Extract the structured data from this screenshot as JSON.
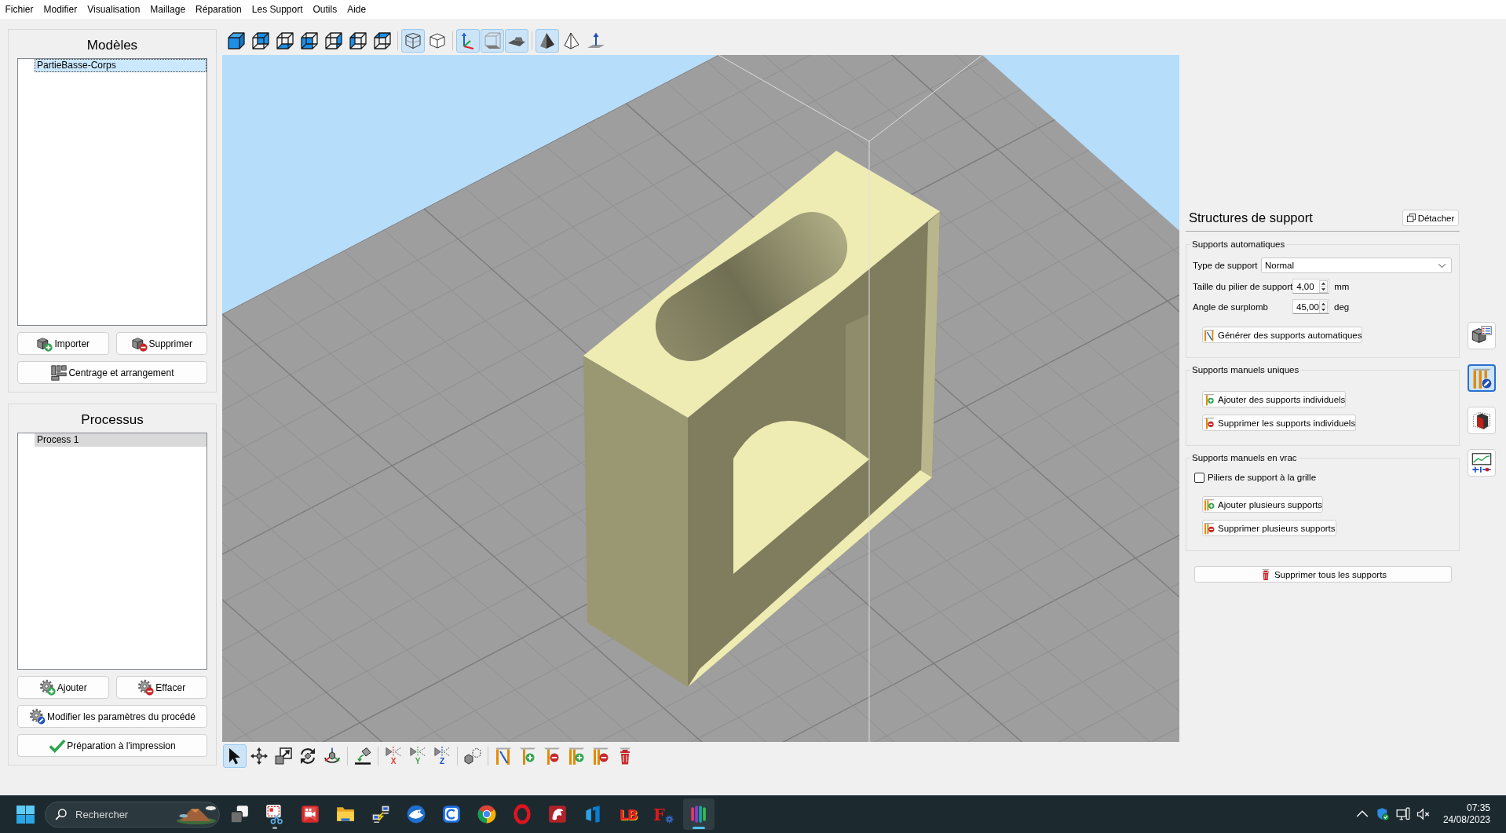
{
  "menu_bar": [
    "Fichier",
    "Modifier",
    "Visualisation",
    "Maillage",
    "Réparation",
    "Les Support",
    "Outils",
    "Aide"
  ],
  "view_toolbar": [
    [
      {
        "kind": "cube-all",
        "selected": false
      },
      {
        "kind": "cube-back",
        "selected": false
      },
      {
        "kind": "cube-bottom",
        "selected": false
      },
      {
        "kind": "cube-front",
        "selected": false
      },
      {
        "kind": "cube-right",
        "selected": false
      },
      {
        "kind": "cube-left",
        "selected": false
      },
      {
        "kind": "cube-top",
        "selected": false
      }
    ],
    [
      {
        "kind": "perspective",
        "selected": true
      },
      {
        "kind": "orthographic",
        "selected": false
      }
    ],
    [
      {
        "kind": "axes",
        "selected": true
      },
      {
        "kind": "bounding-box",
        "selected": true
      },
      {
        "kind": "build-plate",
        "selected": true
      }
    ],
    [
      {
        "kind": "shaded",
        "selected": true
      },
      {
        "kind": "wireframe",
        "selected": false
      },
      {
        "kind": "plate-arrow",
        "selected": false
      }
    ]
  ],
  "models_panel": {
    "title": "Modèles",
    "focused": true,
    "items": [
      {
        "label": "PartieBasse-Corps",
        "selected": true
      }
    ],
    "buttons": [
      [
        {
          "kind": "import",
          "label": "Importer"
        },
        {
          "kind": "remove",
          "label": "Supprimer"
        }
      ],
      [
        {
          "kind": "arrange",
          "label": "Centrage et arrangement"
        }
      ]
    ]
  },
  "process_panel": {
    "title": "Processus",
    "focused": false,
    "items": [
      {
        "label": "Process 1",
        "selected": true
      }
    ],
    "buttons": [
      [
        {
          "kind": "add",
          "label": "Ajouter"
        },
        {
          "kind": "erase",
          "label": "Effacer"
        }
      ],
      [
        {
          "kind": "settings",
          "label": "Modifier les paramètres du procédé"
        }
      ],
      [
        {
          "kind": "prepare",
          "label": "Préparation à l'impression"
        }
      ]
    ]
  },
  "bottom_toolbar": [
    [
      {
        "kind": "select",
        "selected": true
      },
      {
        "kind": "move",
        "selected": false
      },
      {
        "kind": "scale",
        "selected": false
      },
      {
        "kind": "rotate",
        "selected": false
      },
      {
        "kind": "rotate-3d",
        "selected": false
      }
    ],
    [
      {
        "kind": "place-face",
        "selected": false
      }
    ],
    [
      {
        "kind": "mirror",
        "label": "X",
        "color": "#e53935",
        "selected": false
      },
      {
        "kind": "mirror",
        "label": "Y",
        "color": "#43a047",
        "selected": false
      },
      {
        "kind": "mirror",
        "label": "Z",
        "color": "#1e4fc2",
        "selected": false
      }
    ],
    [
      {
        "kind": "duplicate",
        "selected": false
      }
    ],
    [
      {
        "kind": "auto-support",
        "selected": false
      },
      {
        "kind": "add-support",
        "selected": false
      },
      {
        "kind": "remove-support",
        "selected": false
      },
      {
        "kind": "add-supports",
        "selected": false
      },
      {
        "kind": "remove-supports",
        "selected": false
      },
      {
        "kind": "delete-supports",
        "selected": false
      }
    ]
  ],
  "support_panel": {
    "title": "Structures de support",
    "detach_label": "Détacher",
    "groups": [
      {
        "title": "Supports automatiques",
        "rows": [
          {
            "kind": "combo",
            "label": "Type de support",
            "value": "Normal"
          },
          {
            "kind": "spin",
            "label": "Taille du pilier de support",
            "value": "4,00",
            "unit": "mm"
          },
          {
            "kind": "spin",
            "label": "Angle de surplomb",
            "value": "45,00",
            "unit": "deg"
          },
          {
            "kind": "auto-support",
            "label": "Générer des supports automatiques"
          }
        ]
      },
      {
        "title": "Supports manuels uniques",
        "rows": [
          {
            "kind": "add-support",
            "label": "Ajouter des supports individuels"
          },
          {
            "kind": "remove-support",
            "label": "Supprimer les supports individuels"
          }
        ]
      },
      {
        "title": "Supports manuels en vrac",
        "rows": [
          {
            "kind": "checkbox",
            "label": "Piliers de support à la grille",
            "checked": false
          },
          {
            "kind": "add-supports",
            "label": "Ajouter plusieurs supports"
          },
          {
            "kind": "remove-supports",
            "label": "Supprimer plusieurs supports"
          }
        ]
      }
    ],
    "footer_button": {
      "kind": "delete-supports",
      "label": "Supprimer tous les supports"
    }
  },
  "side_toolbar": [
    {
      "kind": "model-info",
      "selected": false
    },
    {
      "kind": "supports-edit",
      "selected": true
    },
    {
      "kind": "part-box",
      "selected": false
    },
    {
      "kind": "chart-settings",
      "selected": false
    }
  ],
  "taskbar": {
    "search": {
      "placeholder": "Rechercher"
    },
    "apps": [
      {
        "kind": "task-view",
        "running": false,
        "active": false
      },
      {
        "kind": "snipping",
        "running": true,
        "active": false
      },
      {
        "kind": "recorder",
        "running": false,
        "active": false
      },
      {
        "kind": "folder",
        "running": false,
        "active": false
      },
      {
        "kind": "network",
        "running": false,
        "active": false
      },
      {
        "kind": "mail-bird",
        "running": false,
        "active": false
      },
      {
        "kind": "c-tile",
        "running": false,
        "active": false
      },
      {
        "kind": "tricolor",
        "running": false,
        "active": false
      },
      {
        "kind": "ring",
        "running": false,
        "active": false
      },
      {
        "kind": "dragon",
        "running": false,
        "active": false
      },
      {
        "kind": "bracket",
        "running": false,
        "active": false
      },
      {
        "kind": "letters",
        "label": "LB",
        "running": false,
        "active": false
      },
      {
        "kind": "letter-gear",
        "label": "F",
        "running": false,
        "active": false
      },
      {
        "kind": "bars",
        "running": true,
        "active": true
      }
    ]
  },
  "tray": {
    "time": "07:35",
    "date": "24/08/2023"
  }
}
